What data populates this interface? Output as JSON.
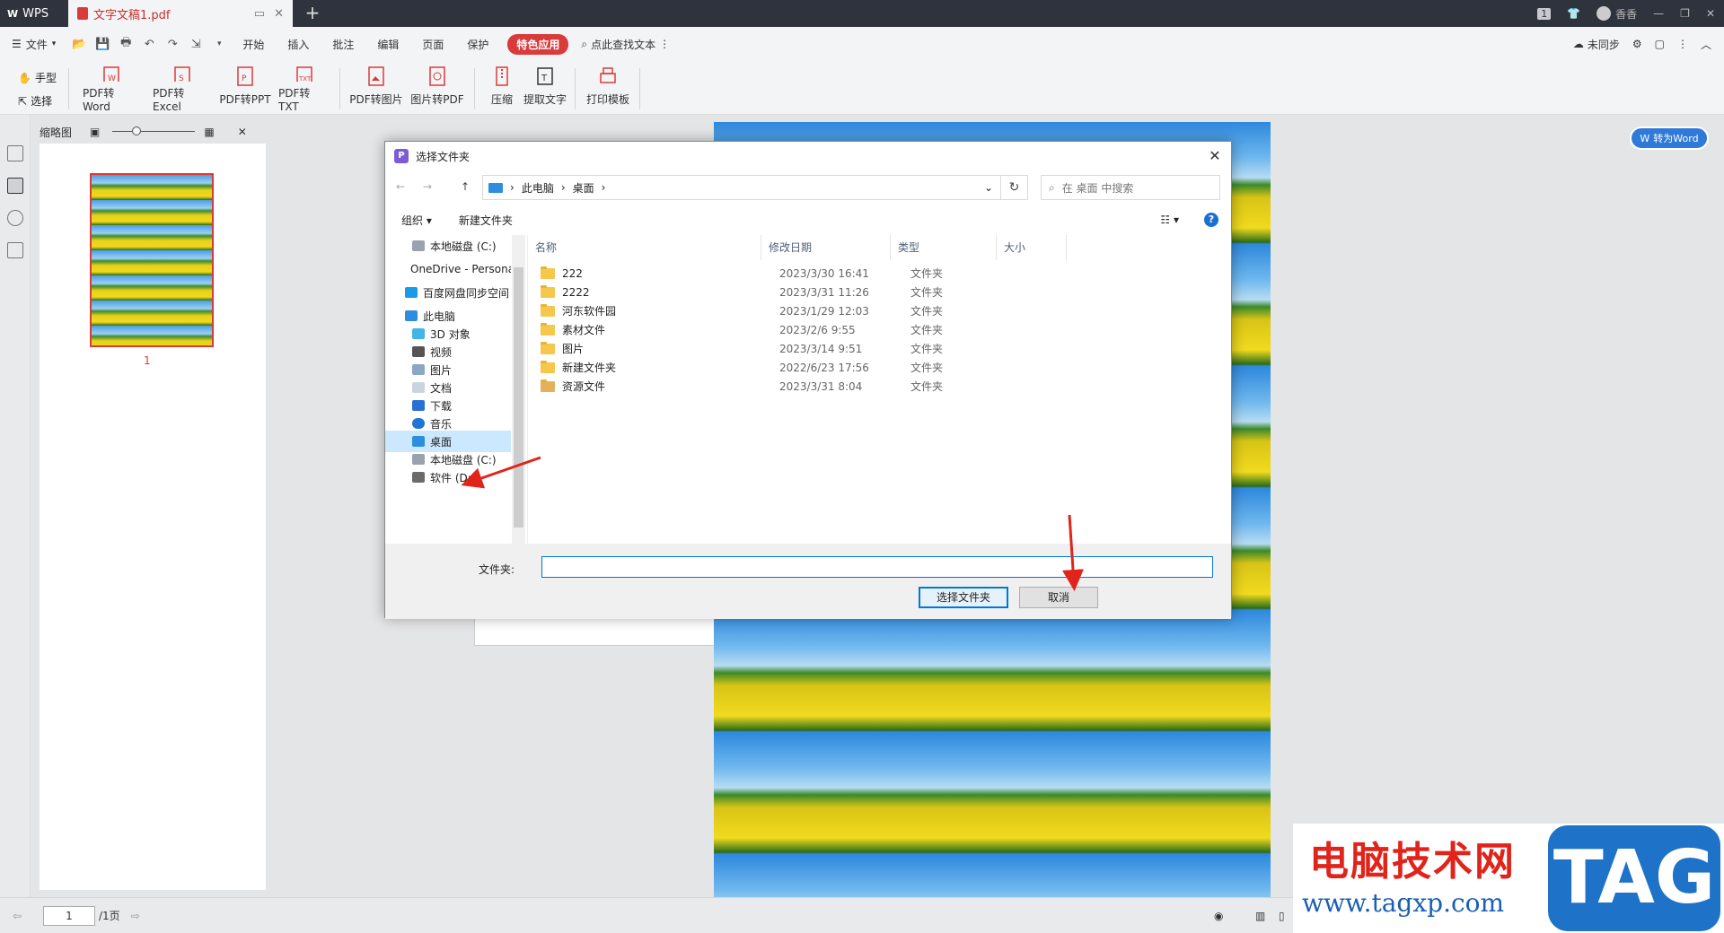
{
  "window": {
    "app_tab": "WPS",
    "doc_tab": "文字文稿1.pdf",
    "page_badge": "1",
    "user": "香香"
  },
  "menubar": {
    "file": "文件",
    "items": [
      "开始",
      "插入",
      "批注",
      "编辑",
      "页面",
      "保护"
    ],
    "special": "特色应用",
    "search": "点此查找文本",
    "sync": "未同步"
  },
  "toolbar": {
    "hand": "手型",
    "select": "选择",
    "buttons": [
      "PDF转Word",
      "PDF转Excel",
      "PDF转PPT",
      "PDF转TXT",
      "PDF转图片",
      "图片转PDF",
      "压缩",
      "提取文字",
      "打印模板"
    ]
  },
  "thumbnail": {
    "title": "缩略图",
    "page_label": "1"
  },
  "float_button": "转为Word",
  "statusbar": {
    "page_value": "1",
    "total": "/1页"
  },
  "dialog": {
    "title": "选择文件夹",
    "address": [
      "此电脑",
      "桌面"
    ],
    "search_placeholder": "在 桌面 中搜索",
    "organize": "组织 ▾",
    "new_folder": "新建文件夹",
    "nav": [
      "本地磁盘 (C:)",
      "OneDrive - Personal",
      "百度网盘同步空间",
      "此电脑",
      "3D 对象",
      "视频",
      "图片",
      "文档",
      "下载",
      "音乐",
      "桌面",
      "本地磁盘 (C:)",
      "软件 (D:)"
    ],
    "columns": {
      "name": "名称",
      "date": "修改日期",
      "type": "类型",
      "size": "大小"
    },
    "files": [
      {
        "name": "222",
        "date": "2023/3/30 16:41",
        "type": "文件夹"
      },
      {
        "name": "2222",
        "date": "2023/3/31 11:26",
        "type": "文件夹"
      },
      {
        "name": "河东软件园",
        "date": "2023/1/29 12:03",
        "type": "文件夹"
      },
      {
        "name": "素材文件",
        "date": "2023/2/6 9:55",
        "type": "文件夹"
      },
      {
        "name": "图片",
        "date": "2023/3/14 9:51",
        "type": "文件夹"
      },
      {
        "name": "新建文件夹",
        "date": "2022/6/23 17:56",
        "type": "文件夹"
      },
      {
        "name": "资源文件",
        "date": "2023/3/31 8:04",
        "type": "文件夹"
      }
    ],
    "folder_label": "文件夹:",
    "folder_value": "",
    "select_button": "选择文件夹",
    "cancel_button": "取消"
  },
  "watermark": {
    "text": "电脑技术网",
    "url": "www.tagxp.com",
    "tag": "TAG"
  },
  "colors": {
    "accent_red": "#d93b3b",
    "dialog_blue": "#0078d7",
    "annotation_red": "#e0241b"
  }
}
